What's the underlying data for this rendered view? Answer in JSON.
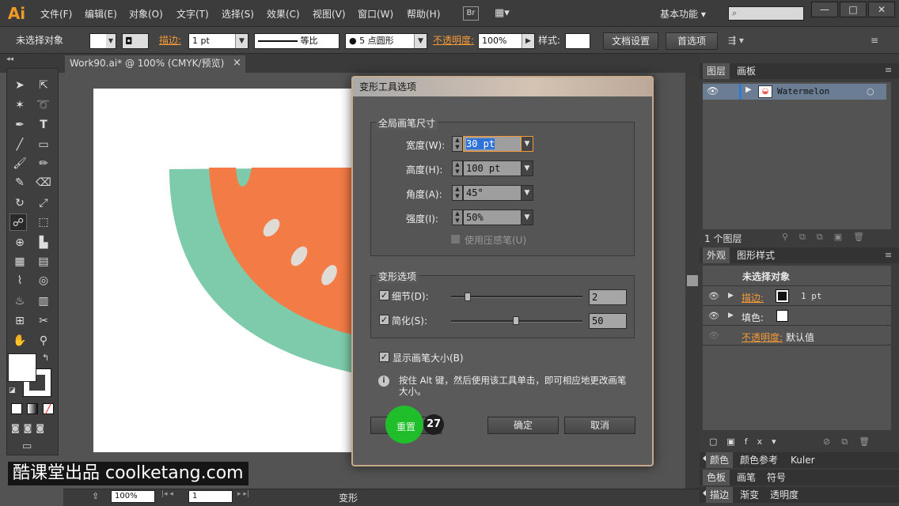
{
  "app": {
    "logo": "Ai",
    "menus": [
      "文件(F)",
      "编辑(E)",
      "对象(O)",
      "文字(T)",
      "选择(S)",
      "效果(C)",
      "视图(V)",
      "窗口(W)",
      "帮助(H)"
    ],
    "bridge": "Br",
    "workspace": "基本功能",
    "window_buttons": [
      "—",
      "□",
      "✕"
    ]
  },
  "control": {
    "selection": "未选择对象",
    "stroke_label": "描边:",
    "stroke_width": "1 pt",
    "stroke_profile": "等比",
    "brush": "5 点圆形",
    "opacity_label": "不透明度:",
    "opacity": "100%",
    "style_label": "样式:",
    "doc_settings": "文档设置",
    "preferences": "首选项"
  },
  "document": {
    "tab_title": "Work90.ai* @ 100% (CMYK/预览)",
    "close": "×"
  },
  "status": {
    "zoom": "100%",
    "page": "1",
    "tool_name": "变形"
  },
  "dialog": {
    "title": "变形工具选项",
    "global": {
      "legend": "全局画笔尺寸",
      "width_label": "宽度(W):",
      "width": "30 pt",
      "height_label": "高度(H):",
      "height": "100 pt",
      "angle_label": "角度(A):",
      "angle": "45°",
      "intensity_label": "强度(I):",
      "intensity": "50%",
      "pressure_label": "使用压感笔(U)"
    },
    "warp": {
      "legend": "变形选项",
      "detail_label": "细节(D):",
      "detail": "2",
      "simplify_label": "简化(S):",
      "simplify": "50"
    },
    "show_brush": "显示画笔大小(B)",
    "hint": "按住 Alt 键，然后使用该工具单击，即可相应地更改画笔大小。",
    "reset": "重置",
    "ok": "确定",
    "cancel": "取消"
  },
  "click_marker": "27",
  "layers": {
    "tabs": [
      "图层",
      "画板"
    ],
    "layer_name": "Watermelon",
    "count": "1 个图层"
  },
  "appearance": {
    "tabs": [
      "外观",
      "图形样式"
    ],
    "header": "未选择对象",
    "stroke_label": "描边:",
    "stroke_value": "1 pt",
    "fill_label": "填色:",
    "opacity_label": "不透明度:",
    "opacity_value": "默认值"
  },
  "bottom_tabs": {
    "row1": [
      "颜色",
      "颜色参考",
      "Kuler"
    ],
    "row2": [
      "色板",
      "画笔",
      "符号"
    ],
    "row3": [
      "描边",
      "渐变",
      "透明度"
    ]
  },
  "watermark": "酷课堂出品 coolketang.com",
  "colors": {
    "rind": "#7ecbab",
    "flesh": "#f37b46",
    "seed": "#e0dbd5",
    "accent": "#f59a36",
    "marker": "#1fc42a"
  }
}
